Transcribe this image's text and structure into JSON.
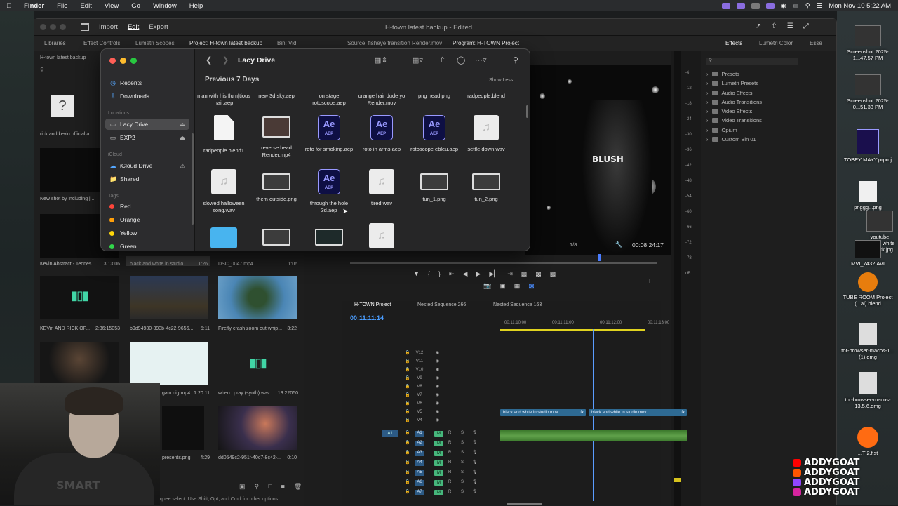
{
  "menubar": {
    "app": "Finder",
    "items": [
      "File",
      "Edit",
      "View",
      "Go",
      "Window",
      "Help"
    ],
    "clock": "Mon Nov 10  5:22 AM"
  },
  "premiere": {
    "nav": {
      "import": "Import",
      "edit": "Edit",
      "export": "Export"
    },
    "doc_title": "H-town latest backup - Edited",
    "tabs": [
      "Libraries",
      "Effect Controls",
      "Lumetri Scopes",
      "Project: H-town latest backup",
      "Bin: Vid",
      "Source: fisheye transition Render.mov",
      "Program: H-TOWN Project"
    ],
    "right_tabs": [
      "Effects",
      "Lumetri Color",
      "Esse"
    ],
    "project": {
      "bin_title": "H-town latest backup",
      "items": [
        {
          "label": "rick and kevin official a...",
          "dur": ""
        },
        {
          "label": "New shot by including j...",
          "dur": ""
        },
        {
          "label": "Kevin Abstract - Tennes...",
          "dur": "3:13:06"
        },
        {
          "label": "black and white in studio...",
          "dur": "1:26"
        },
        {
          "label": "DSC_0047.mp4",
          "dur": "1:06"
        },
        {
          "label": "KEVin AND RICK OF...",
          "dur": "2:36:15053"
        },
        {
          "label": "b9d94930-393b-4c22-9656...",
          "dur": "5:11"
        },
        {
          "label": "Firefly crash zoom out whip...",
          "dur": "3:22"
        },
        {
          "label": "gain nig.mp4",
          "dur": "1:20:11"
        },
        {
          "label": "when i pray (synth).wav",
          "dur": "13:22050"
        },
        {
          "label": "presents.png",
          "dur": "4:29"
        },
        {
          "label": "dd0549c2-951f-40c7-8c42-...",
          "dur": "0:10"
        }
      ]
    },
    "program": {
      "overlay_text": "BLUSH",
      "fraction": "1/8",
      "timecode": "00:08:24:17"
    },
    "timeline": {
      "tabs": [
        "H-TOWN Project",
        "Nested Sequence 266",
        "Nested Sequence 163"
      ],
      "playhead": "00:11:11:14",
      "ruler": [
        "00:11:10:00",
        "00:11:11:00",
        "00:11:12:00",
        "00:11:13:00"
      ],
      "video_tracks": [
        "V12",
        "V11",
        "V10",
        "V9",
        "V8",
        "V7",
        "V6",
        "V5",
        "V4"
      ],
      "audio_tracks": [
        "A1",
        "A2",
        "A3",
        "A4",
        "A5",
        "A6",
        "A7"
      ],
      "clips": [
        "black and white in studio.mov",
        "black and white in studio.mov"
      ],
      "clip_fx": "fx",
      "source_a1": "A1",
      "audio_m": "M",
      "audio_r": "R",
      "audio_s": "S"
    },
    "meter_scale": [
      "-6",
      "-12",
      "-18",
      "-24",
      "-30",
      "-36",
      "-42",
      "-48",
      "-54",
      "-60",
      "-66",
      "-72",
      "-78",
      "dB"
    ],
    "effects": [
      "Presets",
      "Lumetri Presets",
      "Audio Effects",
      "Audio Transitions",
      "Video Effects",
      "Video Transitions",
      "Opium",
      "Custom Bin 01"
    ],
    "status": "quee select. Use Shift, Opt, and Cmd for other options."
  },
  "finder": {
    "title": "Lacy Drive",
    "section": "Previous 7 Days",
    "show_less": "Show Less",
    "sidebar": {
      "favorites": [
        "Recents",
        "Downloads"
      ],
      "locations_label": "Locations",
      "locations": [
        "Lacy Drive",
        "EXP2"
      ],
      "icloud_label": "iCloud",
      "icloud": [
        "iCloud Drive",
        "Shared"
      ],
      "tags_label": "Tags",
      "tags": [
        {
          "name": "Red",
          "color": "#ff453a"
        },
        {
          "name": "Orange",
          "color": "#ff9f0a"
        },
        {
          "name": "Yellow",
          "color": "#ffd60a"
        },
        {
          "name": "Green",
          "color": "#32d74b"
        }
      ]
    },
    "row0": [
      "man with his flum[tious hair.aep",
      "new 3d sky.aep",
      "on stage rotoscope.aep",
      "orange hair dude yo Render.mov",
      "png head.png",
      "radpeople.blend"
    ],
    "row1": [
      {
        "name": "radpeople.blend1",
        "kind": "doc"
      },
      {
        "name": "reverse head Render.mp4",
        "kind": "img"
      },
      {
        "name": "roto for smoking.aep",
        "kind": "ae"
      },
      {
        "name": "roto in arms.aep",
        "kind": "ae"
      },
      {
        "name": "rotoscope ebleu.aep",
        "kind": "ae"
      },
      {
        "name": "settle down.wav",
        "kind": "aud"
      }
    ],
    "row2": [
      {
        "name": "slowed halloween song.wav",
        "kind": "aud"
      },
      {
        "name": "them outside.png",
        "kind": "img"
      },
      {
        "name": "through the hole 3d.aep",
        "kind": "ae"
      },
      {
        "name": "tired.wav",
        "kind": "aud"
      },
      {
        "name": "tun_1.png",
        "kind": "img"
      },
      {
        "name": "tun_2.png",
        "kind": "img"
      }
    ],
    "ae_badge": "Ae",
    "ae_ext": "AEP"
  },
  "desktop": [
    {
      "label": "Screenshot 2025-1...47.57 PM"
    },
    {
      "label": "Screenshot 2025-0...51.33 PM"
    },
    {
      "label": "TOBEY MAYY.prproj"
    },
    {
      "label": "pnggg...png"
    },
    {
      "label": "youtube banner white boi fuck.jpg"
    },
    {
      "label": "MVI_7432.AVI"
    },
    {
      "label": "TUBE ROOM Project (...al).blend"
    },
    {
      "label": "tor-browser-macos-1...(1).dmg"
    },
    {
      "label": "tor-browser-macos-13.5.6.dmg"
    },
    {
      "label": "...T 2.flst"
    }
  ],
  "webcam": {
    "shirt_text": "SMART"
  },
  "social": {
    "handle": "ADDYGOAT",
    "platforms": [
      {
        "name": "youtube",
        "color": "#ff0000"
      },
      {
        "name": "soundcloud",
        "color": "#ff5500"
      },
      {
        "name": "twitch",
        "color": "#9146ff"
      },
      {
        "name": "instagram",
        "color": "#d6249f"
      }
    ]
  }
}
